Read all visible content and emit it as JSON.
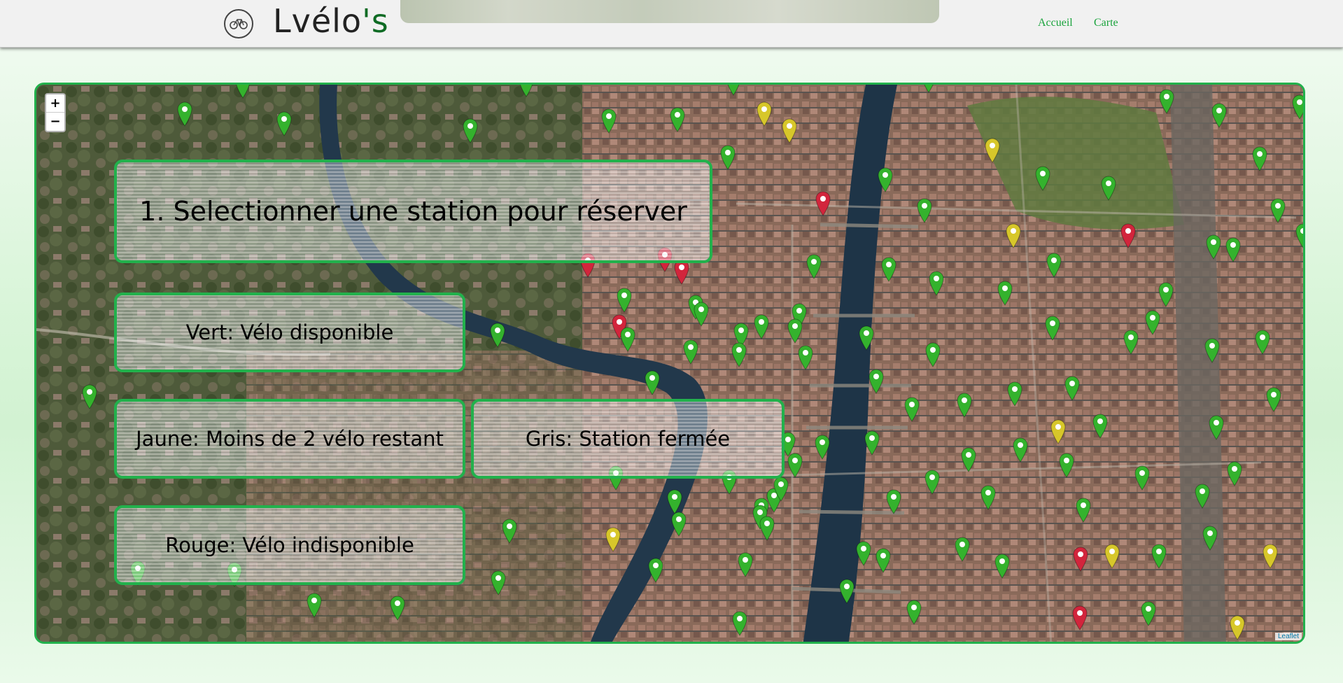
{
  "header": {
    "brand_main": "Lvélo",
    "brand_suffix": "'s",
    "nav": [
      {
        "label": "Accueil"
      },
      {
        "label": "Carte"
      }
    ]
  },
  "map": {
    "zoom_in": "+",
    "zoom_out": "−",
    "attribution": "Leaflet"
  },
  "legend": {
    "title": "1. Selectionner une station pour réserver",
    "green": "Vert: Vélo disponible",
    "yellow": "Jaune: Moins de 2 vélo restant",
    "grey": "Gris: Station fermée",
    "red": "Rouge: Vélo indisponible"
  },
  "colors": {
    "accent": "#22b14c",
    "nav_link": "#1aa33c",
    "marker_green": "#34b22d",
    "marker_yellow": "#d7c72a",
    "marker_red": "#d2253c",
    "river": "#1e3447"
  }
}
